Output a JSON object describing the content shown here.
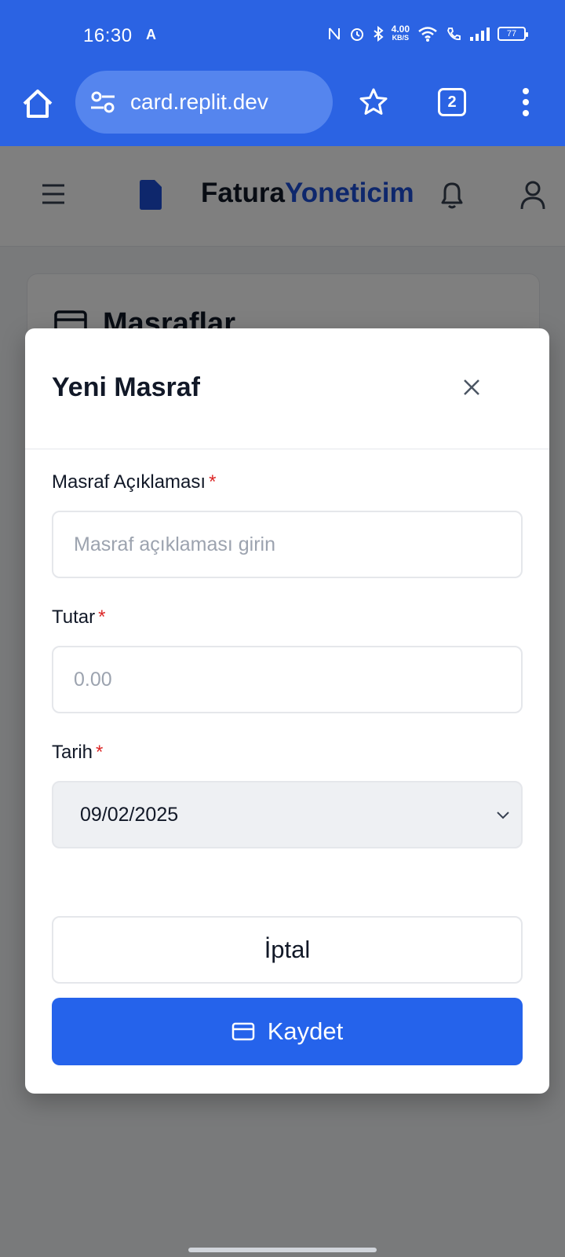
{
  "status_bar": {
    "time": "16:30",
    "net_speed_value": "4.00",
    "net_speed_unit": "KB/S",
    "battery": "77"
  },
  "browser": {
    "url": "card.replit.dev",
    "tab_count": "2"
  },
  "app_header": {
    "brand_part1": "Fatura",
    "brand_part2": "Yoneticim"
  },
  "background_card": {
    "title": "Masraflar"
  },
  "modal": {
    "title": "Yeni Masraf",
    "fields": {
      "description": {
        "label": "Masraf Açıklaması",
        "required_mark": "*",
        "placeholder": "Masraf açıklaması girin",
        "value": ""
      },
      "amount": {
        "label": "Tutar",
        "required_mark": "*",
        "placeholder": "0.00",
        "value": ""
      },
      "date": {
        "label": "Tarih",
        "required_mark": "*",
        "value": "09/02/2025"
      }
    },
    "cancel_label": "İptal",
    "save_label": "Kaydet"
  },
  "colors": {
    "primary": "#2563eb",
    "brand_accent": "#1d4ed8",
    "required": "#dc2626",
    "browser_bar": "#2b63e3"
  }
}
